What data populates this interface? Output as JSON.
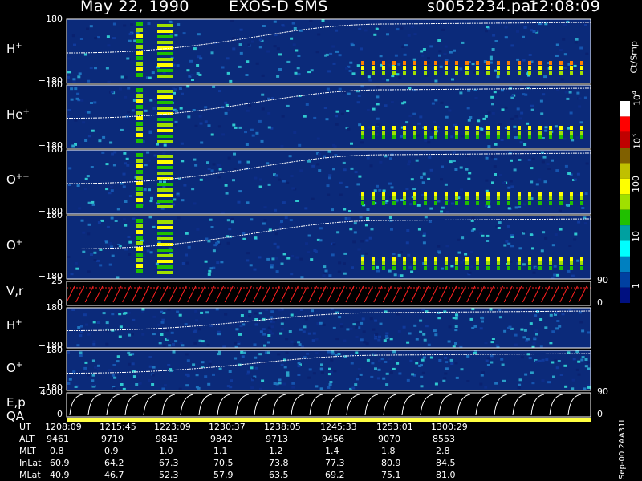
{
  "header": {
    "date": "May 22, 1990",
    "instrument": "EXOS-D SMS",
    "file": "s0052234.par",
    "time": "12:08:09"
  },
  "colors": {
    "background": "#000000",
    "plot_base": "#0b2a7a",
    "velocity_trace": "#ff2020",
    "qa_bar": "#ffff40"
  },
  "panels": [
    {
      "id": "hplus",
      "species": "H",
      "charge": "+",
      "top_tick": "180",
      "bottom_tick": "−180"
    },
    {
      "id": "heplus",
      "species": "He",
      "charge": "+",
      "top_tick": "180",
      "bottom_tick": "−180"
    },
    {
      "id": "oplusplus",
      "species": "O",
      "charge": "++",
      "top_tick": "180",
      "bottom_tick": "−180"
    },
    {
      "id": "oplus",
      "species": "O",
      "charge": "+",
      "top_tick": "180",
      "bottom_tick": "−180"
    },
    {
      "id": "vr",
      "species": "V,r",
      "charge": "",
      "top_tick": "25",
      "bottom_tick": "0",
      "right_top": "90",
      "right_bottom": "0"
    },
    {
      "id": "hplus2",
      "species": "H",
      "charge": "+",
      "top_tick": "180",
      "bottom_tick": "−180"
    },
    {
      "id": "oplus2",
      "species": "O",
      "charge": "+",
      "top_tick": "180",
      "bottom_tick": "−180"
    },
    {
      "id": "ep",
      "species": "E,p",
      "charge": "",
      "top_tick": "4000",
      "bottom_tick": "0",
      "right_top": "90",
      "right_bottom": "0"
    }
  ],
  "qa_label": "QA",
  "colorbar": {
    "unit": "Ct/Smp",
    "labels": [
      {
        "text": "10",
        "sup": "4"
      },
      {
        "text": "10",
        "sup": "3"
      },
      {
        "text": "100",
        "sup": ""
      },
      {
        "text": "10",
        "sup": ""
      },
      {
        "text": "1",
        "sup": ""
      }
    ],
    "colors": [
      "#ffffff",
      "#ff0000",
      "#c00000",
      "#806000",
      "#c0c000",
      "#ffff00",
      "#a0e000",
      "#20c000",
      "#00a0a0",
      "#00ffff",
      "#0080c0",
      "#0040a0",
      "#001080"
    ]
  },
  "footer_id": "Sep-00 2AA31L",
  "chart_data": {
    "type": "heatmap",
    "x_ticks": [
      "1208:09",
      "1215:45",
      "1223:09",
      "1230:37",
      "1238:05",
      "1245:33",
      "1253:01",
      "1300:29"
    ],
    "ephemeris": [
      {
        "label": "UT",
        "values": [
          "1208:09",
          "1215:45",
          "1223:09",
          "1230:37",
          "1238:05",
          "1245:33",
          "1253:01",
          "1300:29"
        ]
      },
      {
        "label": "ALT",
        "values": [
          "9461",
          "9719",
          "9843",
          "9842",
          "9713",
          "9456",
          "9070",
          "8553"
        ]
      },
      {
        "label": "MLT",
        "values": [
          "0.8",
          "0.9",
          "1.0",
          "1.1",
          "1.2",
          "1.4",
          "1.8",
          "2.8"
        ]
      },
      {
        "label": "InLat",
        "values": [
          "60.9",
          "64.2",
          "67.3",
          "70.5",
          "73.8",
          "77.3",
          "80.9",
          "84.5"
        ]
      },
      {
        "label": "MLat",
        "values": [
          "40.9",
          "46.7",
          "52.3",
          "57.9",
          "63.5",
          "69.2",
          "75.1",
          "81.0"
        ]
      }
    ]
  }
}
